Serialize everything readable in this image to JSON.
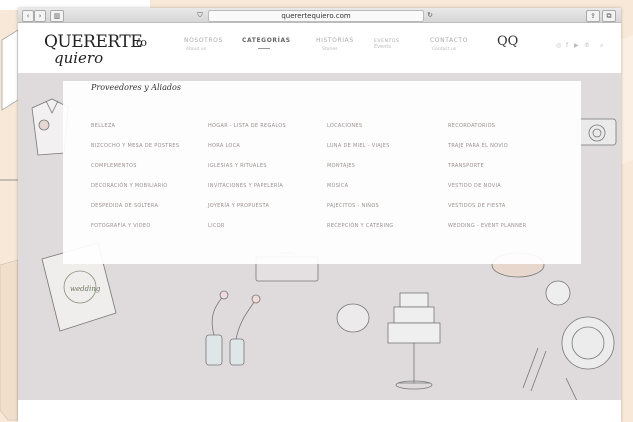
{
  "browser": {
    "url": "querertequiero.com"
  },
  "header": {
    "logo_main": "QUERERTE",
    "logo_sub": "quiero",
    "nav": [
      {
        "label": "NOSOTROS",
        "sub": "About us"
      },
      {
        "label": "CATEGORÍAS",
        "sub": ""
      },
      {
        "label": "HISTORIAS",
        "sub": "Stories"
      },
      {
        "label": "EVENTOS",
        "sub": "Events"
      },
      {
        "label": "CONTACTO",
        "sub": "Contact us"
      }
    ],
    "monogram": "QQ",
    "social_icons": [
      "instagram-icon",
      "facebook-icon",
      "youtube-icon",
      "pinterest-icon",
      "search-icon"
    ]
  },
  "mega_menu": {
    "title": "Proveedores y Aliados",
    "columns": [
      [
        "BELLEZA",
        "BIZCOCHO Y MESA DE POSTRES",
        "COMPLEMENTOS",
        "DECORACIÓN Y MOBILIARIO",
        "DESPEDIDA DE SOLTERA",
        "FOTOGRAFÍA Y VIDEO"
      ],
      [
        "HOGAR - LISTA DE REGALOS",
        "HORA LOCA",
        "IGLESIAS Y RITUALES",
        "INVITACIONES Y PAPELERÍA",
        "JOYERÍA Y PROPUESTA",
        "LICOR"
      ],
      [
        "LOCACIONES",
        "LUNA DE MIEL - VIAJES",
        "MONTAJES",
        "MÚSICA",
        "PAJECITOS - NIÑOS",
        "RECEPCIÓN Y CATERING"
      ],
      [
        "RECORDATORIOS",
        "TRAJE PARA EL NOVIO",
        "TRANSPORTE",
        "VESTIDO DE NOVIA",
        "VESTIDOS DE FIESTA",
        "WEDDING - EVENT PLANNER"
      ]
    ]
  },
  "hero": {
    "wreath_text": "wedding"
  }
}
